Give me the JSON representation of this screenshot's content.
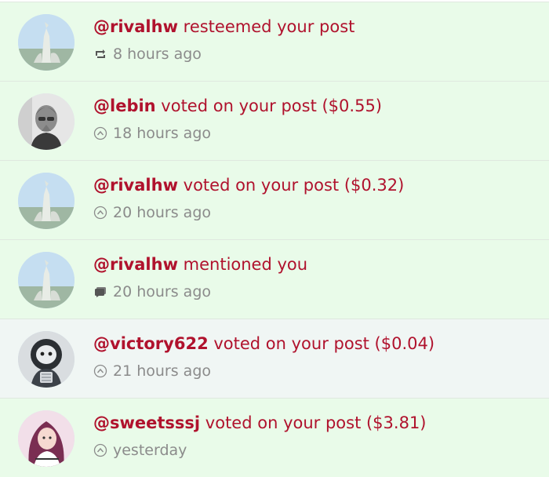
{
  "notifications": [
    {
      "user": "@rivalhw",
      "action": " resteemed your post",
      "time": "8 hours ago",
      "icon": "resteem-icon",
      "read": false
    },
    {
      "user": "@lebin",
      "action": " voted on your post ($0.55)",
      "time": "18 hours ago",
      "icon": "upvote-icon",
      "read": false
    },
    {
      "user": "@rivalhw",
      "action": " voted on your post ($0.32)",
      "time": "20 hours ago",
      "icon": "upvote-icon",
      "read": false
    },
    {
      "user": "@rivalhw",
      "action": " mentioned you",
      "time": "20 hours ago",
      "icon": "mention-icon",
      "read": false
    },
    {
      "user": "@victory622",
      "action": " voted on your post ($0.04)",
      "time": "21 hours ago",
      "icon": "upvote-icon",
      "read": true
    },
    {
      "user": "@sweetsssj",
      "action": " voted on your post ($3.81)",
      "time": "yesterday",
      "icon": "upvote-icon",
      "read": false
    }
  ],
  "colors": {
    "unread_bg": "#e9fbe9",
    "read_bg": "#f0f6f4",
    "accent": "#b0122d",
    "meta": "#8b8b8b"
  }
}
